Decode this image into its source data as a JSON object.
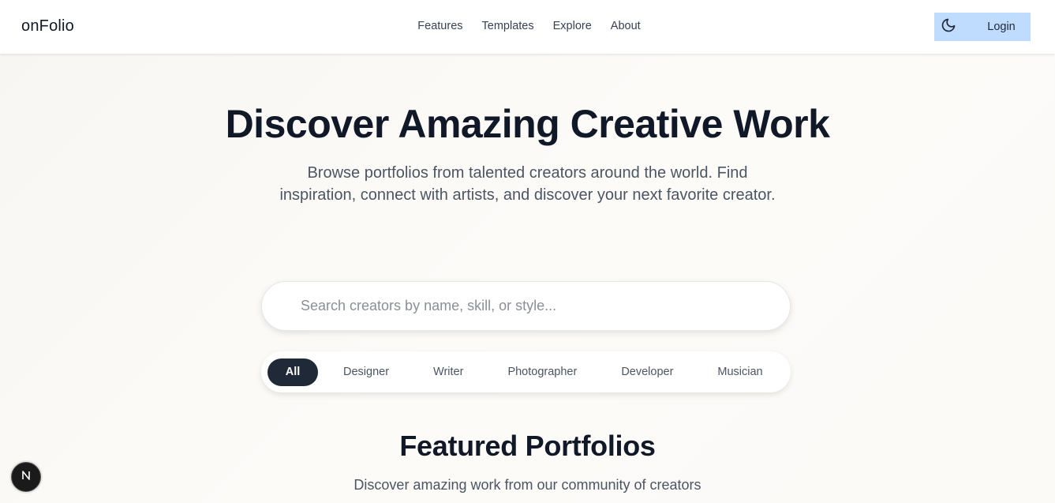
{
  "header": {
    "brand": "onFolio",
    "nav": [
      "Features",
      "Templates",
      "Explore",
      "About"
    ],
    "theme_icon": "moon-icon",
    "login_label": "Login"
  },
  "hero": {
    "title": "Discover Amazing Creative Work",
    "subtitle_line1": "Browse portfolios from talented creators around the world. Find",
    "subtitle_line2": "inspiration, connect with artists, and discover your next favorite creator."
  },
  "search": {
    "placeholder": "Search creators by name, skill, or style...",
    "value": ""
  },
  "filters": {
    "selected": "All",
    "items": [
      "All",
      "Designer",
      "Writer",
      "Photographer",
      "Developer",
      "Musician"
    ]
  },
  "featured": {
    "title": "Featured Portfolios",
    "subtitle": "Discover amazing work from our community of creators"
  },
  "badge": {
    "icon": "nextjs-logo-icon",
    "letter": "N"
  },
  "colors": {
    "accent_light_blue": "#bfdbfe",
    "active_filter": "#1f2937",
    "background": "#fbf9f6"
  }
}
